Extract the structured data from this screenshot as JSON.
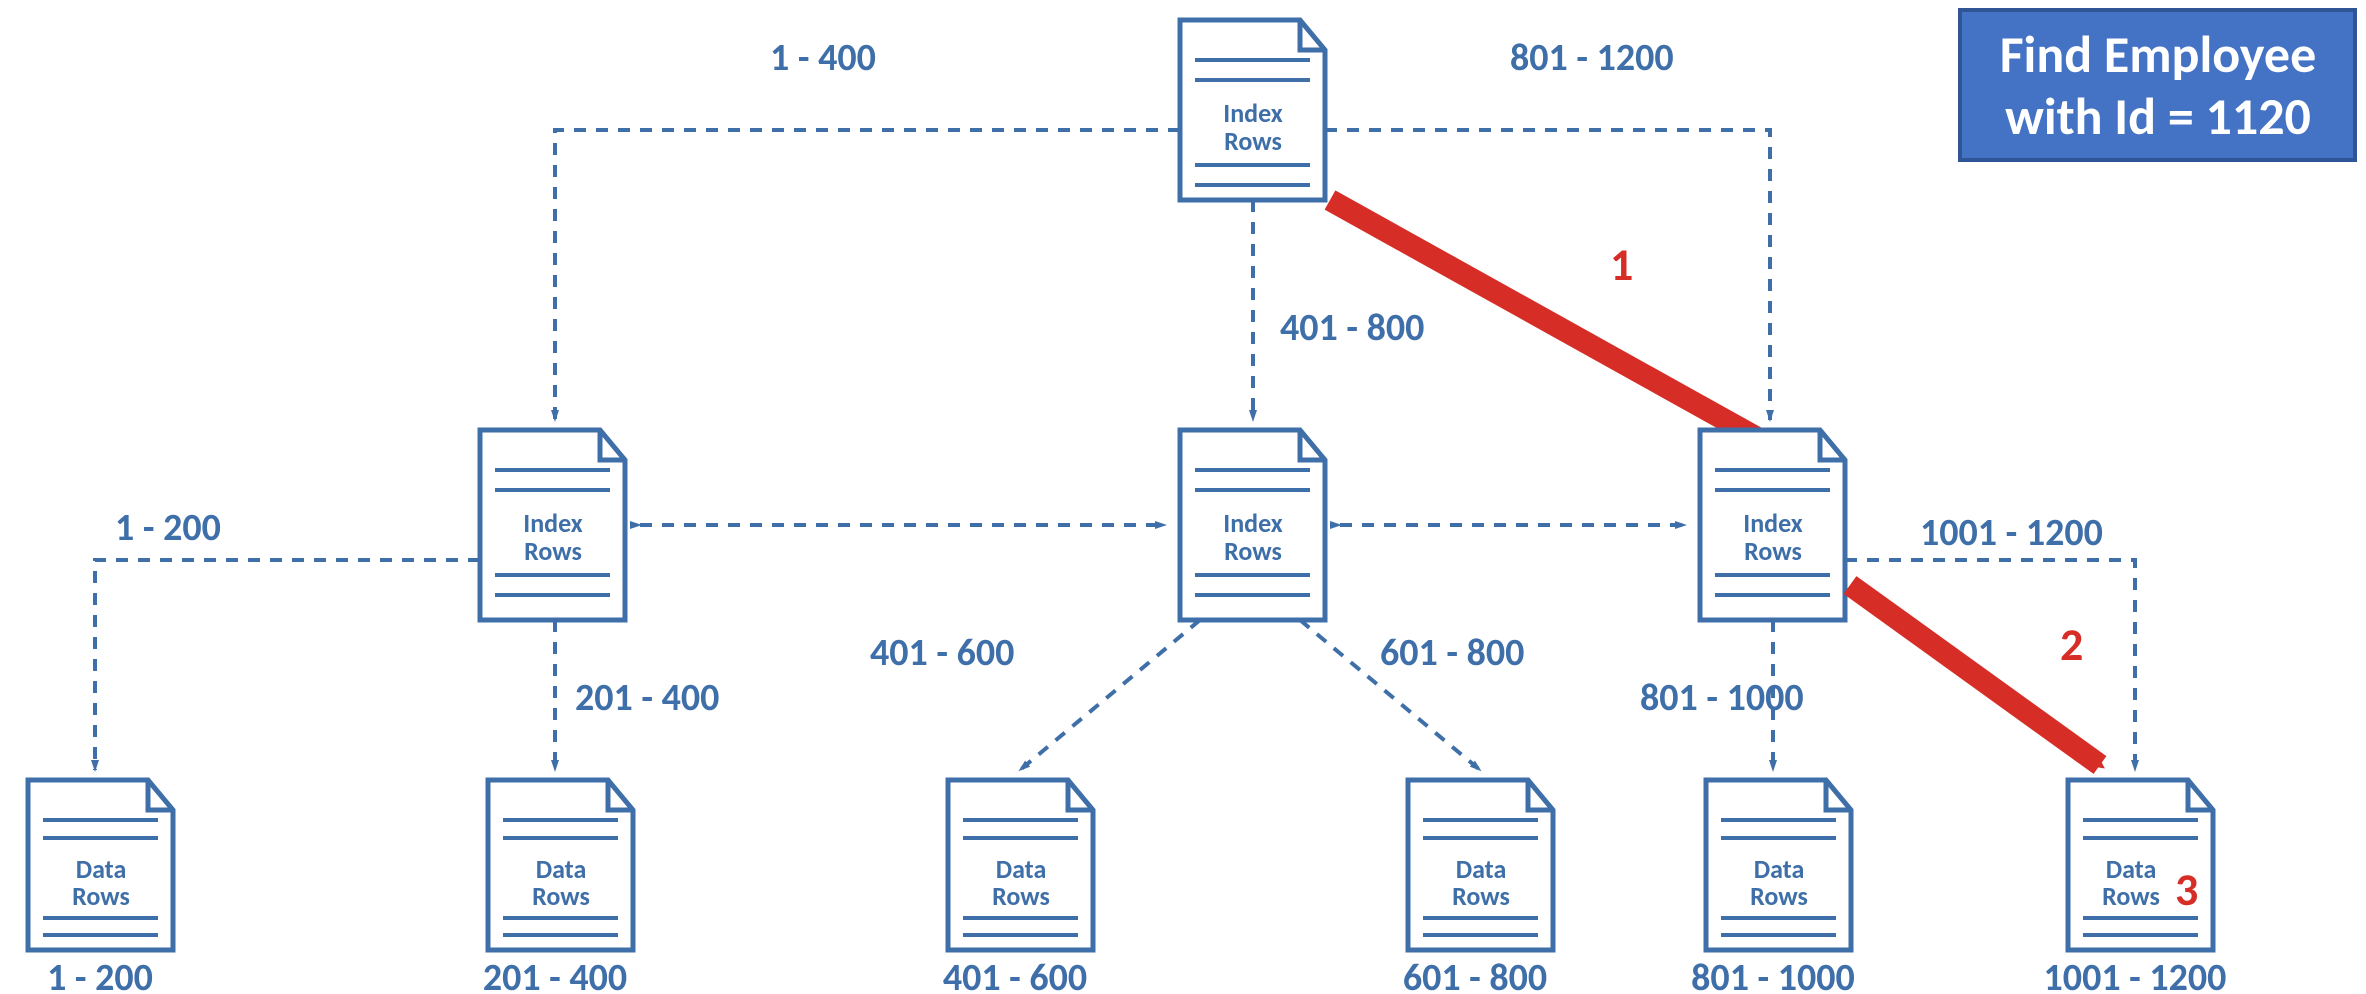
{
  "banner": {
    "line1": "Find Employee",
    "line2": "with Id = 1120"
  },
  "root": {
    "type": "Index Rows",
    "label_line1": "Index",
    "label_line2": "Rows",
    "left_range": "1 - 400",
    "mid_range": "401 - 800",
    "right_range": "801 - 1200"
  },
  "mid_nodes": {
    "left": {
      "label_line1": "Index",
      "label_line2": "Rows",
      "left_range": "1 - 200",
      "right_range": "201 - 400"
    },
    "center": {
      "label_line1": "Index",
      "label_line2": "Rows",
      "left_range": "401 - 600",
      "right_range": "601 - 800"
    },
    "right": {
      "label_line1": "Index",
      "label_line2": "Rows",
      "left_range": "801 - 1000",
      "right_range": "1001 - 1200"
    }
  },
  "leaf_nodes": {
    "l1": {
      "label_line1": "Data",
      "label_line2": "Rows",
      "range": "1 - 200"
    },
    "l2": {
      "label_line1": "Data",
      "label_line2": "Rows",
      "range": "201 - 400"
    },
    "l3": {
      "label_line1": "Data",
      "label_line2": "Rows",
      "range": "401 - 600"
    },
    "l4": {
      "label_line1": "Data",
      "label_line2": "Rows",
      "range": "601 - 800"
    },
    "l5": {
      "label_line1": "Data",
      "label_line2": "Rows",
      "range": "801 - 1000"
    },
    "l6": {
      "label_line1": "Data",
      "label_line2": "Rows",
      "range": "1001 - 1200"
    }
  },
  "steps": {
    "s1": "1",
    "s2": "2",
    "s3": "3"
  },
  "colors": {
    "stroke": "#3f6fa8",
    "red": "#d62e27",
    "banner_bg": "#4472c4"
  }
}
